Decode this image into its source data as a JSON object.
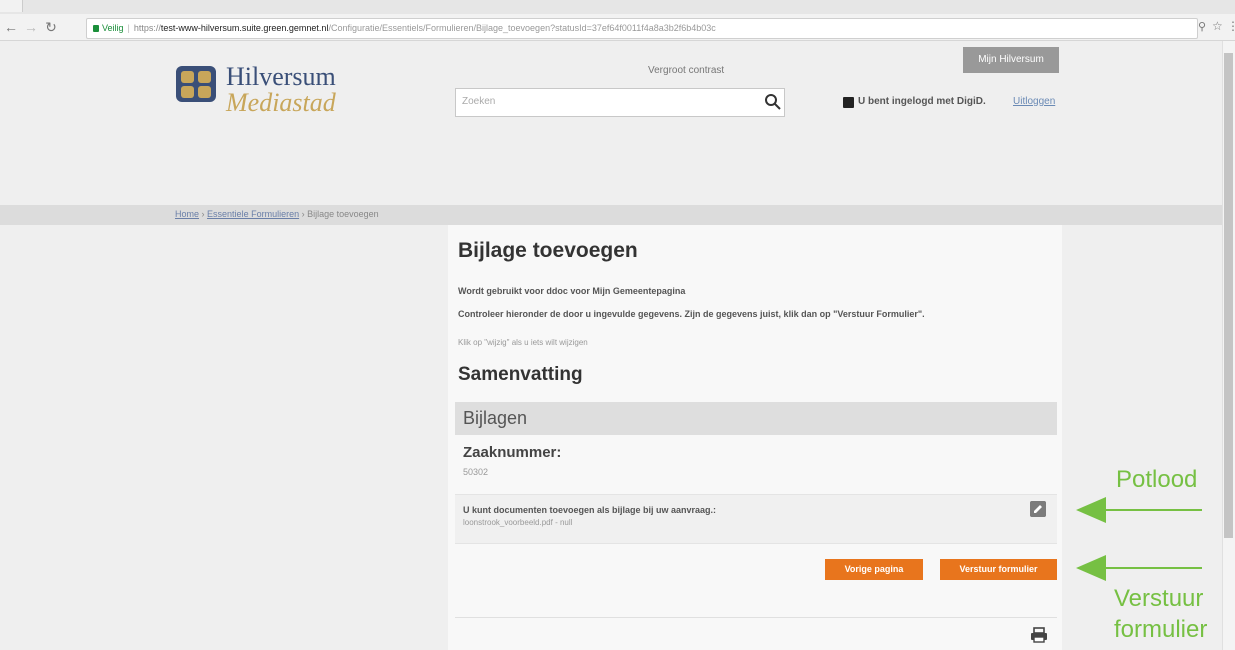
{
  "browser": {
    "security_label": "Veilig",
    "url_scheme": "https://",
    "url_host": "test-www-hilversum.suite.green.gemnet.nl",
    "url_path": "/Configuratie/Essentiels/Formulieren/Bijlage_toevoegen?statusId=37ef64f0011f4a8a3b2f6b4b03c"
  },
  "header": {
    "logo_line1": "Hilversum",
    "logo_line2": "Mediastad",
    "contrast_link": "Vergroot contrast",
    "search_placeholder": "Zoeken",
    "mijn_button": "Mijn Hilversum",
    "digid_text": "U bent ingelogd met DigiD.",
    "logout_link": "Uitloggen"
  },
  "breadcrumb": {
    "home": "Home",
    "forms": "Essentiele Formulieren",
    "current": "Bijlage toevoegen",
    "separator": "›"
  },
  "main": {
    "title": "Bijlage toevoegen",
    "intro1": "Wordt gebruikt voor ddoc voor Mijn Gemeentepagina",
    "intro2": "Controleer hieronder de door u ingevulde gegevens. Zijn de gegevens juist, klik dan op \"Verstuur Formulier\".",
    "intro3": "Klik op \"wijzig\" als u iets wilt wijzigen",
    "summary_title": "Samenvatting",
    "section_title": "Bijlagen",
    "zaak_label": "Zaaknummer:",
    "zaak_value": "50302",
    "upload_label": "U kunt documenten toevoegen als bijlage bij uw aanvraag.:",
    "upload_value": "loonstrook_voorbeeld.pdf - null",
    "next_button": "Vorige pagina",
    "send_button": "Verstuur formulier"
  },
  "annotations": {
    "pencil_label": "Potlood",
    "send_label_line1": "Verstuur",
    "send_label_line2": "formulier"
  },
  "colors": {
    "accent_orange": "#e8751d",
    "annotation_green": "#76c043",
    "logo_blue": "#3a4f78",
    "logo_gold": "#c8a65a"
  }
}
